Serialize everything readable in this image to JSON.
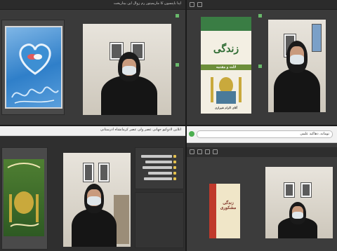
{
  "quadrants": {
    "top_left": {
      "title": "اپنا باپنسوں کا ماریمیتور رم زوال این بیناریخت"
    },
    "top_right": {
      "book_cover": {
        "title": "زندگی",
        "subtitle": "لالت و مقدمه",
        "author": "آقای اکرام شیرازی"
      }
    },
    "bottom_left": {
      "title": "آنلاین لادوکیو جهانی عصر ولی عصر کرمانشاه ادرستانی"
    },
    "bottom_right": {
      "browser_url": "تومانه، دهاکید علمی",
      "book_cover": {
        "title": "زندگی مشکوری"
      }
    }
  },
  "colors": {
    "frame_bg": "#3a3a3a",
    "panel_bg": "#4a4a4a",
    "video_wall": "#e4e0d8",
    "chador": "#151515",
    "mask": "#dfe6ea",
    "heart_card_bg": "#2f7fc9",
    "book_green": "#2e5a23",
    "book_cream": "#f3efe3"
  },
  "icons": [
    "camera-icon",
    "pencil-icon",
    "undo-icon",
    "grid-icon",
    "folder-icon",
    "chrome-icon"
  ]
}
